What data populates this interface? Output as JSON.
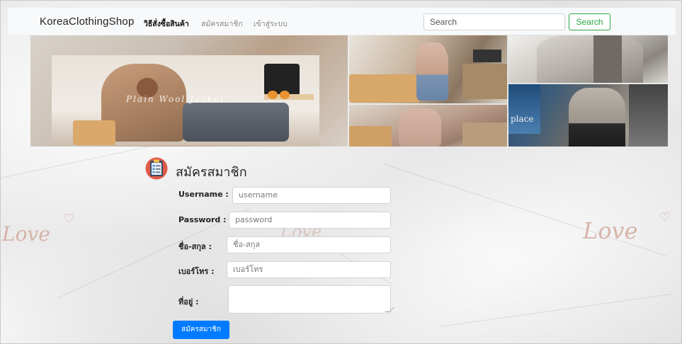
{
  "navbar": {
    "brand": "KoreaClothingShop",
    "links": [
      "วิธีสั่งซื้อสินค้า",
      "สมัครสมาชิก",
      "เข้าสู่ระบบ"
    ],
    "search_placeholder": "Search",
    "search_button": "Search"
  },
  "banner": {
    "main_caption": "Plain Wool Jacket",
    "side_caption": "place"
  },
  "decor": {
    "love_left": "Love",
    "love_center": "Love",
    "love_right": "Love"
  },
  "form": {
    "title": "สมัครสมาชิก",
    "fields": [
      {
        "label": "Username :",
        "placeholder": "username"
      },
      {
        "label": "Password :",
        "placeholder": "password"
      },
      {
        "label": "ชื่อ-สกุล :",
        "placeholder": "ชื่อ-สกุล"
      },
      {
        "label": "เบอร์โทร :",
        "placeholder": "เบอร์โทร"
      },
      {
        "label": "ที่อยู่ :",
        "placeholder": ""
      }
    ],
    "submit": "สมัครสมาชิก"
  },
  "colors": {
    "primary": "#007bff",
    "success": "#28a745",
    "navbar_bg": "#f8f9fa"
  }
}
